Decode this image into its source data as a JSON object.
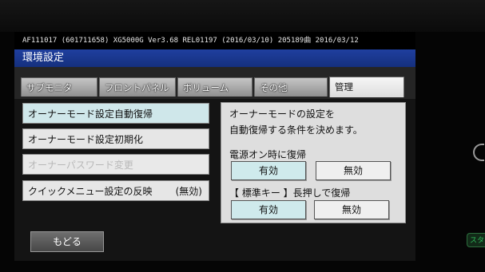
{
  "info_bar": "AF111017 (601711658) XG5000G Ver3.68 REL01197 (2016/03/10) 205189曲 2016/03/12",
  "window_title": "環境設定",
  "tabs": [
    {
      "label": "サブモニタ",
      "active": false
    },
    {
      "label": "フロントパネル",
      "active": false
    },
    {
      "label": "ボリューム",
      "active": false
    },
    {
      "label": "その他",
      "active": false
    },
    {
      "label": "管理",
      "active": true
    }
  ],
  "menu": {
    "items": [
      {
        "label": "オーナーモード設定自動復帰",
        "state": "selected"
      },
      {
        "label": "オーナーモード設定初期化",
        "state": "normal"
      },
      {
        "label": "オーナーパスワード変更",
        "state": "disabled"
      },
      {
        "label": "クイックメニュー設定の反映",
        "value": "(無効)",
        "state": "normal"
      }
    ]
  },
  "detail": {
    "description_line1": "オーナーモードの設定を",
    "description_line2": "自動復帰する条件を決めます。",
    "option1": {
      "label": "電源オン時に復帰",
      "enable": "有効",
      "disable": "無効",
      "selected": "有効"
    },
    "option2": {
      "label": "【 標準キー 】長押しで復帰",
      "enable": "有効",
      "disable": "無効",
      "selected": "有効"
    }
  },
  "back_button": "もどる",
  "side_label": "スタ"
}
